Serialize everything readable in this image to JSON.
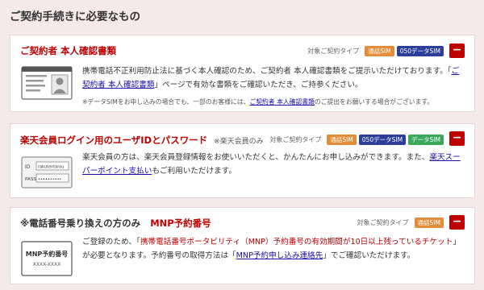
{
  "page": {
    "title": "ご契約手続きに必要なもの"
  },
  "colors": {
    "accent": "#bf0000",
    "background": "#f6e9e9",
    "badge_voice_sim": "#e38d3a",
    "badge_050_data": "#2d3e9a",
    "badge_data_sim": "#3aa85c",
    "link": "#1a0dab"
  },
  "type_label": "対象ご契約タイプ",
  "minus_symbol": "−",
  "sections": [
    {
      "title": "ご契約者 本人確認書類",
      "badges": [
        "通話SIM",
        "050データSIM"
      ],
      "desc": {
        "p1": "携帯電話不正利用防止法に基づく本人確認のため、ご契約者 本人確認書類をご提示いただけております。「",
        "link1": "ご契約者 本人確認書類",
        "p2": "」ページで有効な書類をご確認いただき、ご持参ください。"
      },
      "note": {
        "p1": "※データSIMをお申し込みの場合でも、一部のお客様には、",
        "link": "ご契約者 本人確認書類",
        "p2": "のご提出をお願いする場合がございます。"
      },
      "icon": "id-card-icon"
    },
    {
      "title": "楽天会員ログイン用のユーザIDとパスワード",
      "subtitle": "※楽天会員のみ",
      "badges": [
        "通話SIM",
        "050データSIM",
        "データSIM"
      ],
      "desc": {
        "p1": "楽天会員の方は、楽天会員登録情報をお使いいただくと、かんたんにお申し込みができます。また、",
        "link1": "楽天スーパーポイント支払い",
        "p2": "もご利用いただけます。"
      },
      "login_card": {
        "id_label": "ID",
        "id_value": "rakutentarou",
        "pass_label": "PASS",
        "pass_value": "••••••••••"
      },
      "icon": "login-card-icon"
    },
    {
      "title": "※電話番号乗り換えの方のみ",
      "title_mnp": "MNP予約番号",
      "badges": [
        "通話SIM"
      ],
      "desc": {
        "p1": "ご登録のため、「",
        "red1": "携帯電話番号ポータビリティ（MNP）予約番号の有効期間が10日以上残っているチケット",
        "p2": "」が必要となります。予約番号の取得方法は「",
        "link1": "MNP予約申し込み連絡先",
        "p3": "」でご確認いただけます。"
      },
      "mnp_card": {
        "line1": "MNP予約番号",
        "line2": "XXXX-XXXX"
      },
      "icon": "mnp-ticket-icon"
    }
  ]
}
